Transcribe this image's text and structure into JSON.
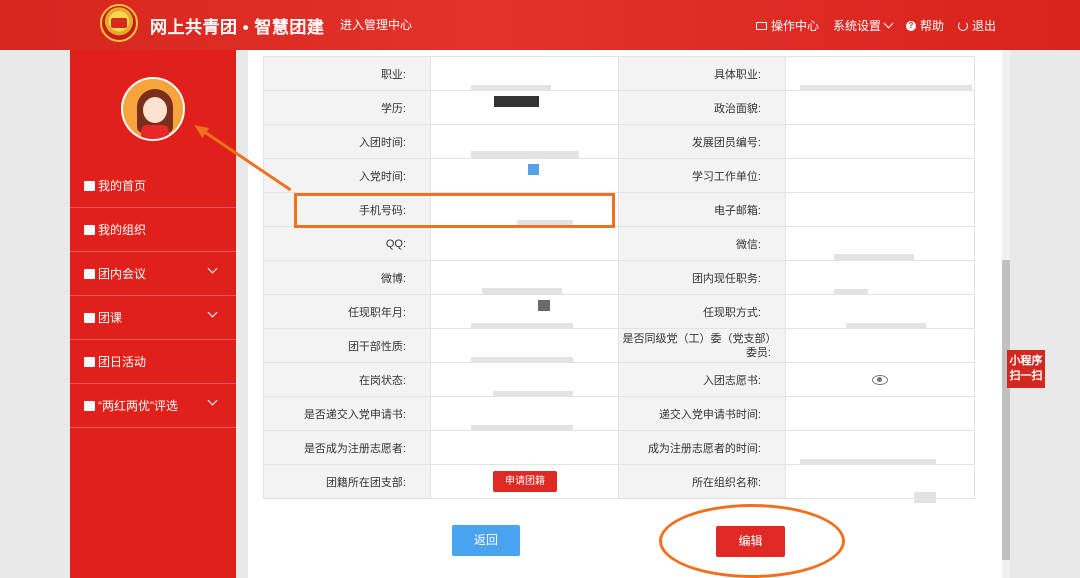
{
  "header": {
    "brand": "网上共青团 • 智慧团建",
    "admin_link": "进入管理中心",
    "nav": [
      {
        "label": "操作中心",
        "icon": "mail-icon"
      },
      {
        "label": "系统设置",
        "icon": "chevron-down-icon"
      },
      {
        "label": "帮助",
        "icon": "help-icon"
      },
      {
        "label": "退出",
        "icon": "power-icon"
      }
    ]
  },
  "sidebar": {
    "items": [
      {
        "label": "我的首页",
        "icon": "home-icon",
        "expandable": false
      },
      {
        "label": "我的组织",
        "icon": "users-icon",
        "expandable": false
      },
      {
        "label": "团内会议",
        "icon": "edit-icon",
        "expandable": true
      },
      {
        "label": "团课",
        "icon": "folder-icon",
        "expandable": true
      },
      {
        "label": "团日活动",
        "icon": "recycle-icon",
        "expandable": false
      },
      {
        "label": "“两红两优”评选",
        "icon": "edit-icon",
        "expandable": true
      }
    ]
  },
  "table": {
    "rows": [
      {
        "left_label": "职业:",
        "right_label": "具体职业:"
      },
      {
        "left_label": "学历:",
        "right_label": "政治面貌:"
      },
      {
        "left_label": "入团时间:",
        "right_label": "发展团员编号:"
      },
      {
        "left_label": "入党时间:",
        "right_label": "学习工作单位:"
      },
      {
        "left_label": "手机号码:",
        "right_label": "电子邮箱:"
      },
      {
        "left_label": "QQ:",
        "right_label": "微信:"
      },
      {
        "left_label": "微博:",
        "right_label": "团内现任职务:"
      },
      {
        "left_label": "任现职年月:",
        "right_label": "任现职方式:"
      },
      {
        "left_label": "团干部性质:",
        "right_label": "是否同级党（工）委（党支部）委员:"
      },
      {
        "left_label": "在岗状态:",
        "right_label": "入团志愿书:"
      },
      {
        "left_label": "是否递交入党申请书:",
        "right_label": "递交入党申请书时间:"
      },
      {
        "left_label": "是否成为注册志愿者:",
        "right_label": "成为注册志愿者的时间:"
      },
      {
        "left_label": "团籍所在团支部:",
        "right_label": "所在组织名称:"
      }
    ],
    "apply_button": "申请团籍"
  },
  "actions": {
    "back": "返回",
    "edit": "编辑"
  },
  "mini_program": "小程序扫一扫",
  "colors": {
    "brand_red": "#e2201b",
    "annotation_orange": "#f1701c",
    "back_blue": "#4aa3ee"
  }
}
